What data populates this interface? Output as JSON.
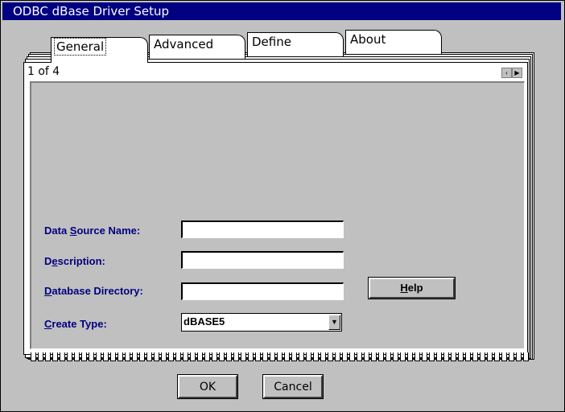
{
  "window": {
    "title": "ODBC dBase Driver Setup"
  },
  "tabs": [
    {
      "label": "General"
    },
    {
      "label": "Advanced"
    },
    {
      "label": "Define"
    },
    {
      "label": "About"
    }
  ],
  "page": {
    "indicator": "1 of 4"
  },
  "form": {
    "dsn_label_pre": "Data ",
    "dsn_label_u": "S",
    "dsn_label_post": "ource Name:",
    "desc_label_pre": "D",
    "desc_label_u": "e",
    "desc_label_post": "scription:",
    "dir_label_pre": "",
    "dir_label_u": "D",
    "dir_label_post": "atabase Directory:",
    "type_label_pre": "",
    "type_label_u": "C",
    "type_label_post": "reate Type:",
    "dsn_value": "",
    "desc_value": "",
    "dir_value": "",
    "create_type": "dBASE5"
  },
  "buttons": {
    "help_u": "H",
    "help_rest": "elp",
    "ok": "OK",
    "cancel": "Cancel"
  }
}
